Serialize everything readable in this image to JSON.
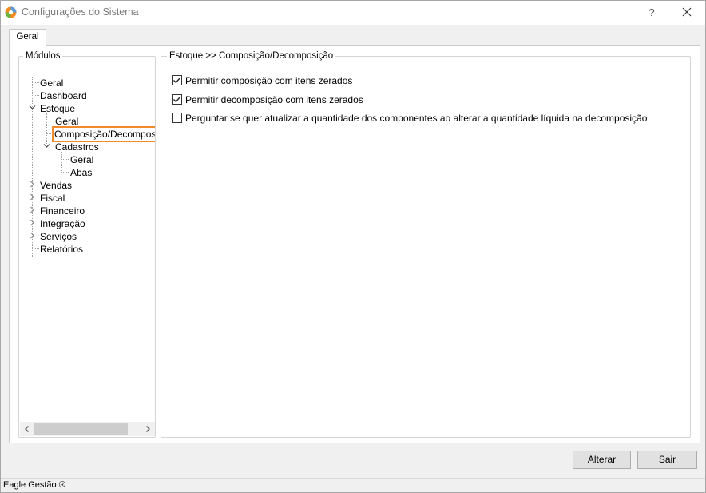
{
  "window": {
    "title": "Configurações do Sistema",
    "help_label": "?",
    "close_icon": "close-icon"
  },
  "tabs": [
    {
      "label": "Geral",
      "selected": true
    }
  ],
  "modules": {
    "legend": "Módulos",
    "tree": [
      {
        "label": "Geral",
        "level": 0
      },
      {
        "label": "Dashboard",
        "level": 0
      },
      {
        "label": "Estoque",
        "level": 0,
        "expanded": true
      },
      {
        "label": "Geral",
        "level": 1
      },
      {
        "label": "Composição/Decomposição",
        "level": 1,
        "selected": true
      },
      {
        "label": "Cadastros",
        "level": 1,
        "expanded": true
      },
      {
        "label": "Geral",
        "level": 2
      },
      {
        "label": "Abas",
        "level": 2
      },
      {
        "label": "Vendas",
        "level": 0,
        "expanded": false
      },
      {
        "label": "Fiscal",
        "level": 0,
        "expanded": false
      },
      {
        "label": "Financeiro",
        "level": 0,
        "expanded": false
      },
      {
        "label": "Integração",
        "level": 0,
        "expanded": false
      },
      {
        "label": "Serviços",
        "level": 0,
        "expanded": false
      },
      {
        "label": "Relatórios",
        "level": 0
      }
    ],
    "highlight_color": "#f08a2a"
  },
  "content": {
    "legend": "Estoque >> Composição/Decomposição",
    "options": [
      {
        "label": "Permitir composição com itens zerados",
        "checked": true
      },
      {
        "label": "Permitir decomposição com itens zerados",
        "checked": true
      },
      {
        "label": "Perguntar se quer atualizar a quantidade dos componentes ao alterar a quantidade líquida na decomposição",
        "checked": false
      }
    ]
  },
  "buttons": {
    "alterar": "Alterar",
    "sair": "Sair"
  },
  "status": {
    "text": "Eagle Gestão ®"
  }
}
